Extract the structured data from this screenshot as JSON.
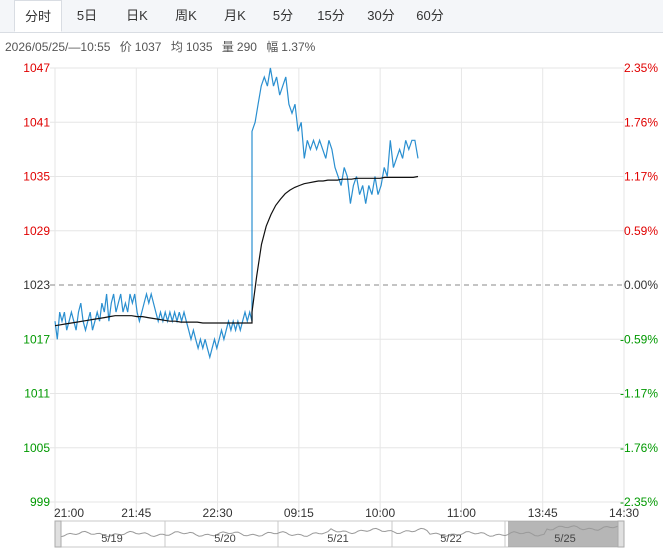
{
  "tabs": [
    "分时",
    "5日",
    "日K",
    "周K",
    "月K",
    "5分",
    "15分",
    "30分",
    "60分"
  ],
  "active_tab": "分时",
  "info": {
    "datetime": "2026/05/25/—10:55",
    "price_label": "价",
    "price": "1037",
    "avg_label": "均",
    "avg": "1035",
    "vol_label": "量",
    "vol": "290",
    "amp_label": "幅",
    "amp": "1.37%"
  },
  "colors": {
    "up": "#e00000",
    "down": "#009900",
    "neutral": "#333333",
    "price_line": "#2a8fd0",
    "avg_line": "#111111",
    "grid": "#e6e6e6",
    "navigator": "#9a9a9a"
  },
  "chart_data": {
    "type": "line",
    "ylim": [
      999,
      1047
    ],
    "prev_close": 1023,
    "left_ticks": [
      "1047",
      "1041",
      "1035",
      "1029",
      "1023",
      "1017",
      "1011",
      "1005",
      "999"
    ],
    "right_ticks": [
      "2.35%",
      "1.76%",
      "1.17%",
      "0.59%",
      "0.00%",
      "-0.59%",
      "-1.17%",
      "-1.76%",
      "-2.35%"
    ],
    "x_ticks": [
      "21:00",
      "21:45",
      "22:30",
      "09:15",
      "10:00",
      "11:00",
      "13:45",
      "14:30"
    ],
    "x_slots": 8,
    "series": [
      {
        "values": [
          1019,
          1017,
          1020,
          1019,
          1020,
          1018,
          1019,
          1020,
          1019,
          1018,
          1020,
          1021,
          1019,
          1018,
          1019,
          1020,
          1018,
          1019,
          1020,
          1019,
          1021,
          1020,
          1022,
          1019,
          1021,
          1022,
          1020,
          1021,
          1022,
          1020,
          1021,
          1020,
          1022,
          1021,
          1022,
          1020,
          1019,
          1020,
          1021,
          1022,
          1021,
          1022,
          1021,
          1020,
          1019,
          1020,
          1019,
          1020,
          1019,
          1020,
          1019,
          1020,
          1019,
          1020,
          1019,
          1020,
          1019,
          1018,
          1017,
          1018,
          1017,
          1016,
          1017,
          1016,
          1017,
          1016,
          1015,
          1016,
          1017,
          1016,
          1017,
          1018,
          1017,
          1018,
          1019,
          1018,
          1019,
          1018,
          1019,
          1018,
          1019,
          1020,
          1019,
          1020,
          1019,
          1040,
          1041,
          1043,
          1045,
          1046,
          1045,
          1047,
          1045,
          1046,
          1044,
          1045,
          1046,
          1043,
          1042,
          1043,
          1040,
          1041,
          1037,
          1039,
          1038,
          1039,
          1038,
          1039,
          1038,
          1037,
          1039,
          1038,
          1036,
          1035,
          1034,
          1036,
          1035,
          1032,
          1034,
          1035,
          1033,
          1034,
          1032,
          1034,
          1033,
          1035,
          1033,
          1034,
          1036,
          1035,
          1039,
          1036,
          1037,
          1038,
          1037,
          1039,
          1038,
          1039,
          1039,
          1037
        ]
      },
      {
        "values": [
          1018.5,
          1018.6,
          1018.7,
          1018.8,
          1018.9,
          1019.0,
          1019.1,
          1019.2,
          1019.3,
          1019.4,
          1019.5,
          1019.6,
          1019.6,
          1019.6,
          1019.6,
          1019.5,
          1019.5,
          1019.4,
          1019.3,
          1019.2,
          1019.1,
          1019.0,
          1019.0,
          1018.9,
          1018.9,
          1018.9,
          1018.9,
          1018.8,
          1018.8,
          1018.8,
          1018.8,
          1018.8,
          1018.8,
          1018.8,
          1018.8,
          1018.8,
          1018.8,
          1020.0,
          1024.0,
          1027.5,
          1029.5,
          1030.8,
          1031.8,
          1032.5,
          1033.1,
          1033.5,
          1033.8,
          1034.0,
          1034.2,
          1034.3,
          1034.4,
          1034.5,
          1034.5,
          1034.6,
          1034.6,
          1034.6,
          1034.7,
          1034.7,
          1034.7,
          1034.8,
          1034.8,
          1034.8,
          1034.8,
          1034.8,
          1034.8,
          1034.9,
          1034.9,
          1034.9,
          1034.9,
          1034.9,
          1034.9,
          1034.9,
          1035.0
        ]
      }
    ],
    "navigator_dates": [
      "5/19",
      "5/20",
      "5/21",
      "5/22",
      "5/25"
    ]
  }
}
